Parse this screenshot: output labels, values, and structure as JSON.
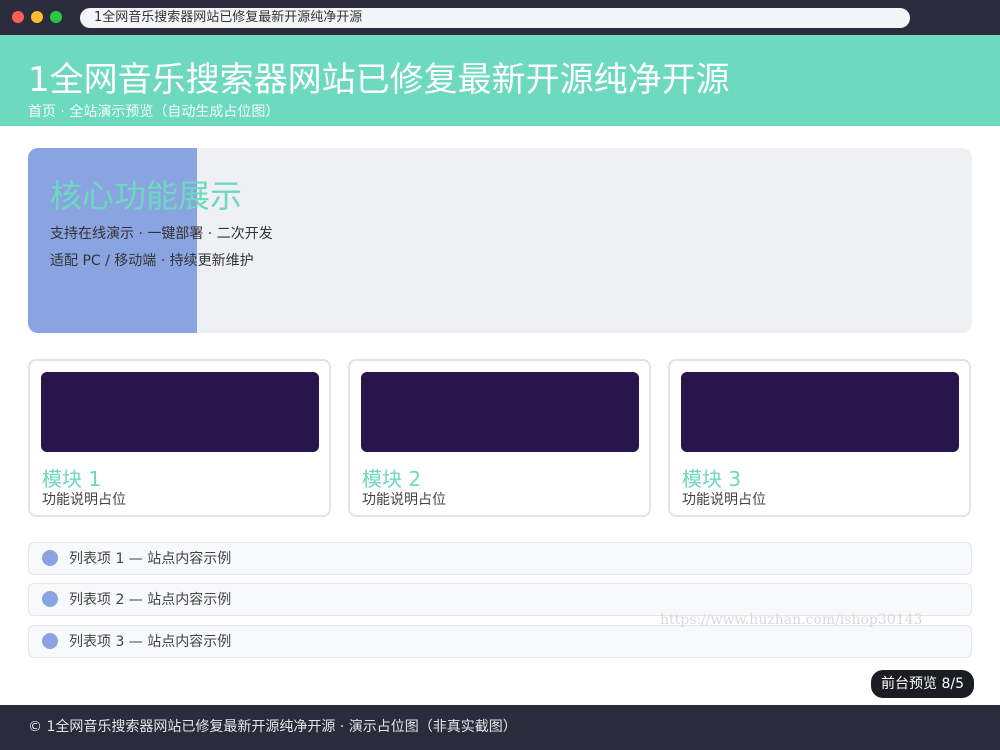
{
  "window": {
    "address": "1全网音乐搜索器网站已修复最新开源纯净开源"
  },
  "header": {
    "title": "1全网音乐搜索器网站已修复最新开源纯净开源",
    "breadcrumb": "首页 · 全站演示预览（自动生成占位图）"
  },
  "banner": {
    "title": "核心功能展示",
    "line1": "支持在线演示 · 一键部署 · 二次开发",
    "line2": "适配 PC / 移动端 · 持续更新维护"
  },
  "cards": [
    {
      "title": "模块 1",
      "desc": "功能说明占位"
    },
    {
      "title": "模块 2",
      "desc": "功能说明占位"
    },
    {
      "title": "模块 3",
      "desc": "功能说明占位"
    }
  ],
  "list": [
    {
      "label": "列表项 1 — 站点内容示例"
    },
    {
      "label": "列表项 2 — 站点内容示例"
    },
    {
      "label": "列表项 3 — 站点内容示例"
    }
  ],
  "watermark": "https://www.huzhan.com/ishop30143",
  "preview_badge": "前台预览 8/5",
  "footer": {
    "text": "© 1全网音乐搜索器网站已修复最新开源纯净开源 · 演示占位图（非真实截图）"
  },
  "colors": {
    "accent": "#6dd9be",
    "banner_accent": "#8aa3e1",
    "thumb": "#27154b",
    "dark": "#2a2b3c"
  }
}
